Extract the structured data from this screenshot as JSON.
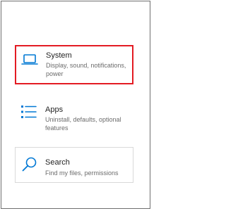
{
  "settings": {
    "categories": [
      {
        "id": "system",
        "title": "System",
        "description": "Display, sound, notifications, power",
        "icon": "laptop-icon",
        "highlighted": true
      },
      {
        "id": "apps",
        "title": "Apps",
        "description": "Uninstall, defaults, optional features",
        "icon": "apps-list-icon",
        "highlighted": false
      },
      {
        "id": "search",
        "title": "Search",
        "description": "Find my files, permissions",
        "icon": "search-icon",
        "highlighted": false
      }
    ]
  },
  "colors": {
    "accent": "#0078d4",
    "highlight": "#e31b23",
    "title_text": "#1f1f1f",
    "description_text": "#6b6b6b",
    "card_border": "#d9d9d9"
  }
}
